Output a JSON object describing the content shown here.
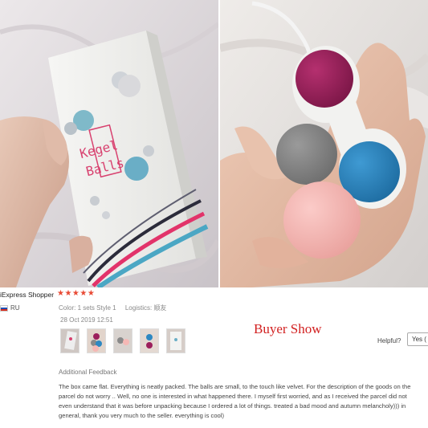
{
  "photos": {
    "box_text_line1": "Kegel",
    "box_text_line2": "Balls"
  },
  "review": {
    "shopper_name": "iExpress Shopper",
    "stars": "★★★★★",
    "country": "RU",
    "color_label": "Color:",
    "color_value": "1 sets Style 1",
    "logistics_label": "Logistics:",
    "logistics_value": "顺友",
    "date": "28 Oct 2019 12:51",
    "buyer_show": "Buyer Show",
    "helpful_label": "Helpful?",
    "yes_label": "Yes (",
    "additional_label": "Additional Feedback",
    "feedback_text": "The box came flat. Everything is neatly packed. The balls are small, to the touch like velvet. For the description of the goods on the parcel do not worry .. Well, no one is interested in what happened there. I myself first worried, and as I received the parcel did not even understand that it was before unpacking because I ordered a lot of things. treated a bad mood and autumn melancholy))) in general, thank you very much to the seller. everything is cool)"
  },
  "colors": {
    "star": "#e84a35",
    "buyer_show": "#d21f1f",
    "ball_magenta": "#9c1f5c",
    "ball_grey": "#8a8a8a",
    "ball_blue": "#2e88c2",
    "ball_pink": "#f5b8b5"
  }
}
